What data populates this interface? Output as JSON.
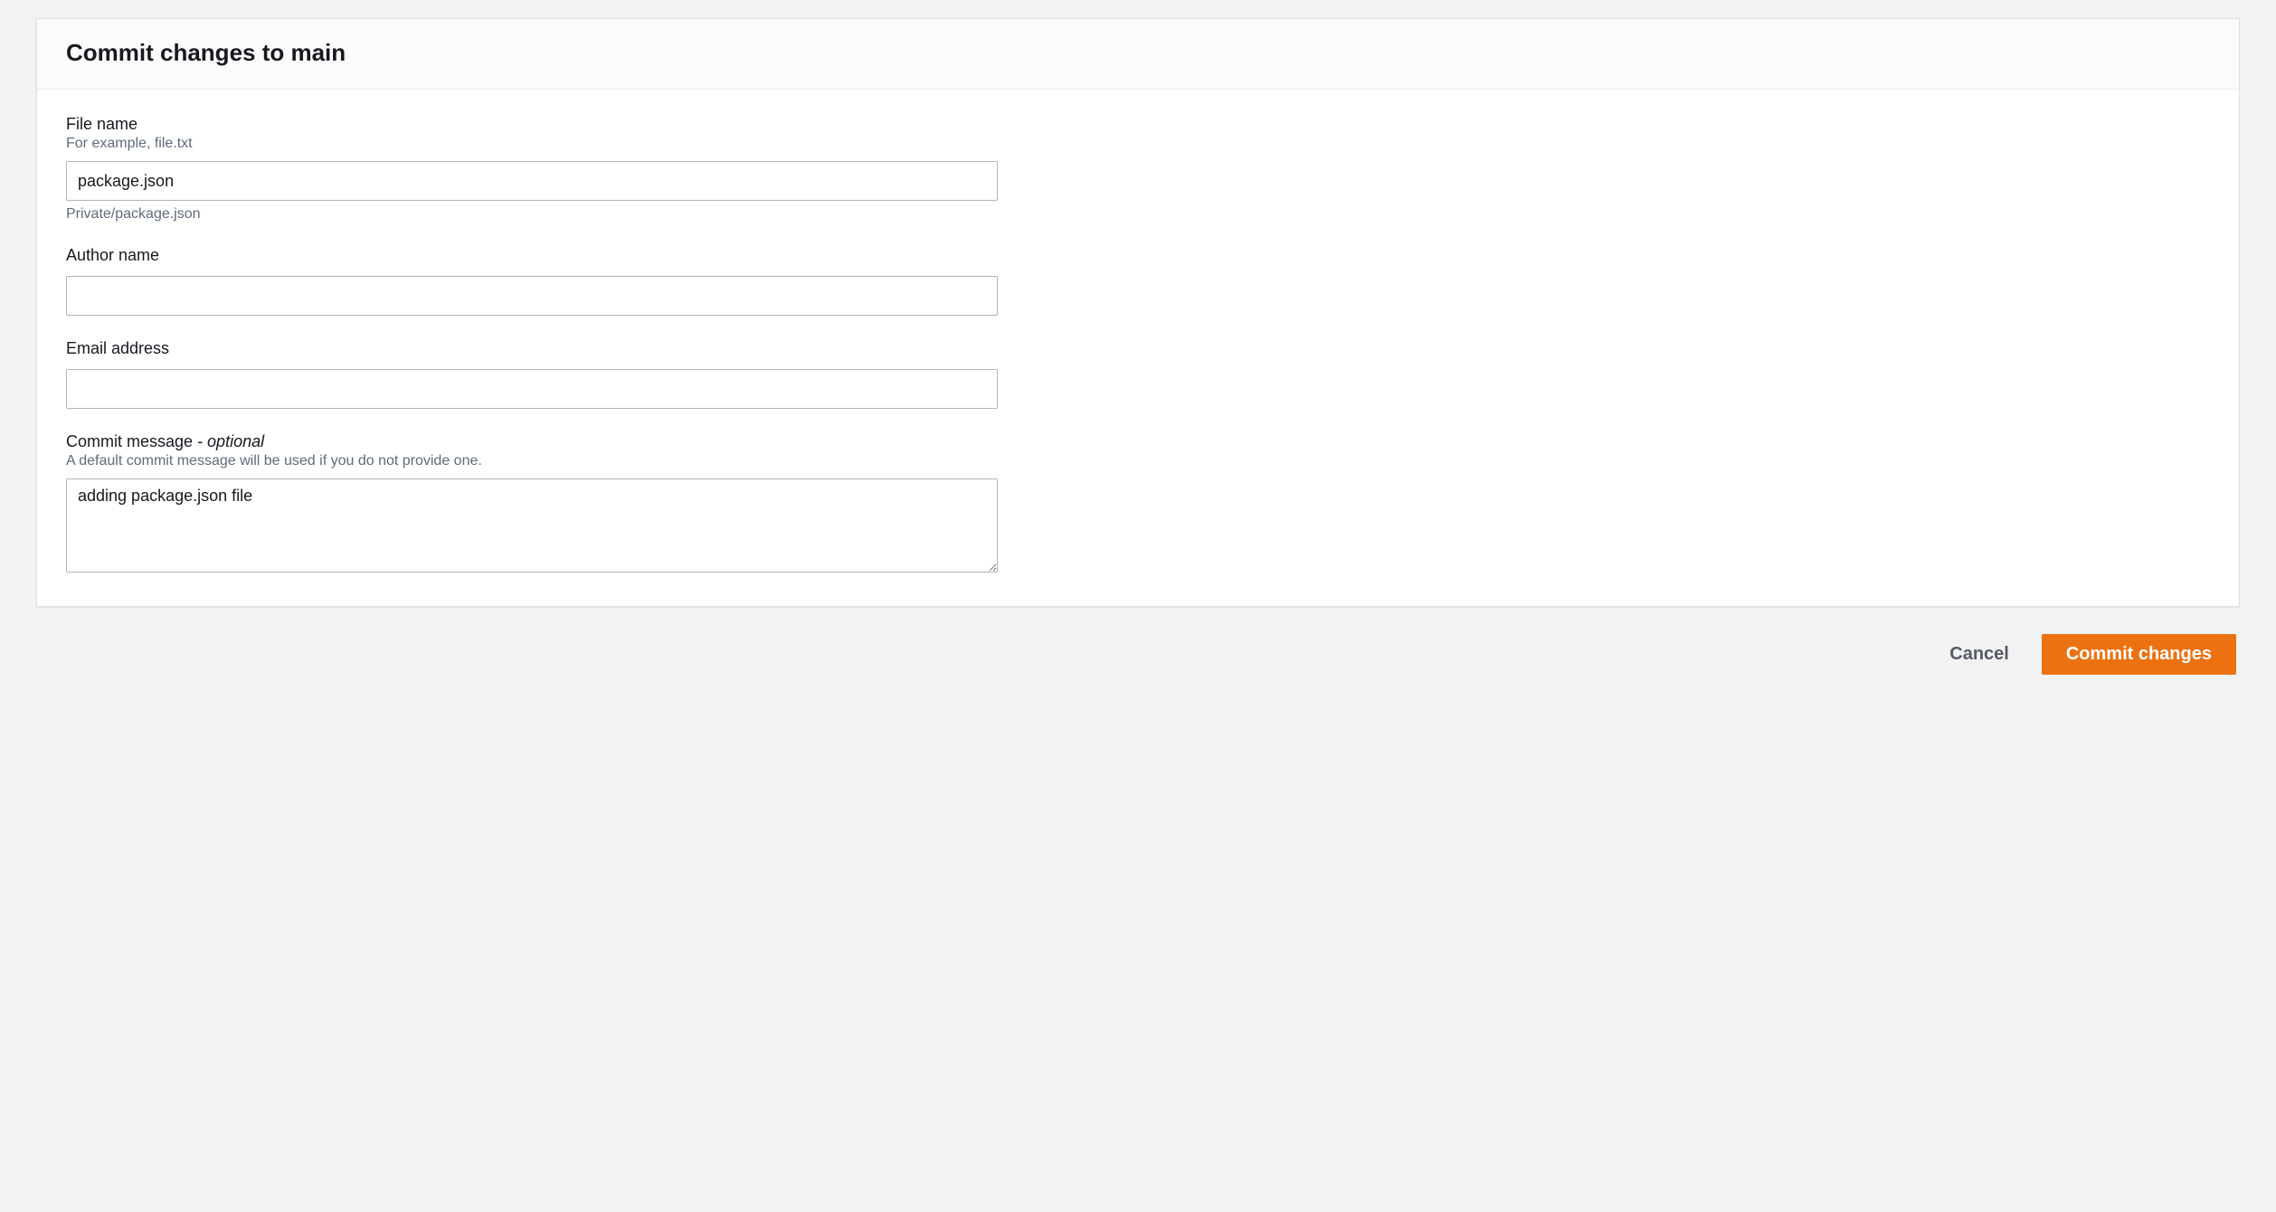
{
  "panel": {
    "title": "Commit changes to main"
  },
  "fields": {
    "filename": {
      "label": "File name",
      "hint": "For example, file.txt",
      "value": "package.json",
      "below": "Private/package.json"
    },
    "author": {
      "label": "Author name",
      "value": ""
    },
    "email": {
      "label": "Email address",
      "value": ""
    },
    "message": {
      "label": "Commit message",
      "optional_suffix": " - optional",
      "hint": "A default commit message will be used if you do not provide one.",
      "value": "adding package.json file"
    }
  },
  "actions": {
    "cancel": "Cancel",
    "commit": "Commit changes"
  }
}
